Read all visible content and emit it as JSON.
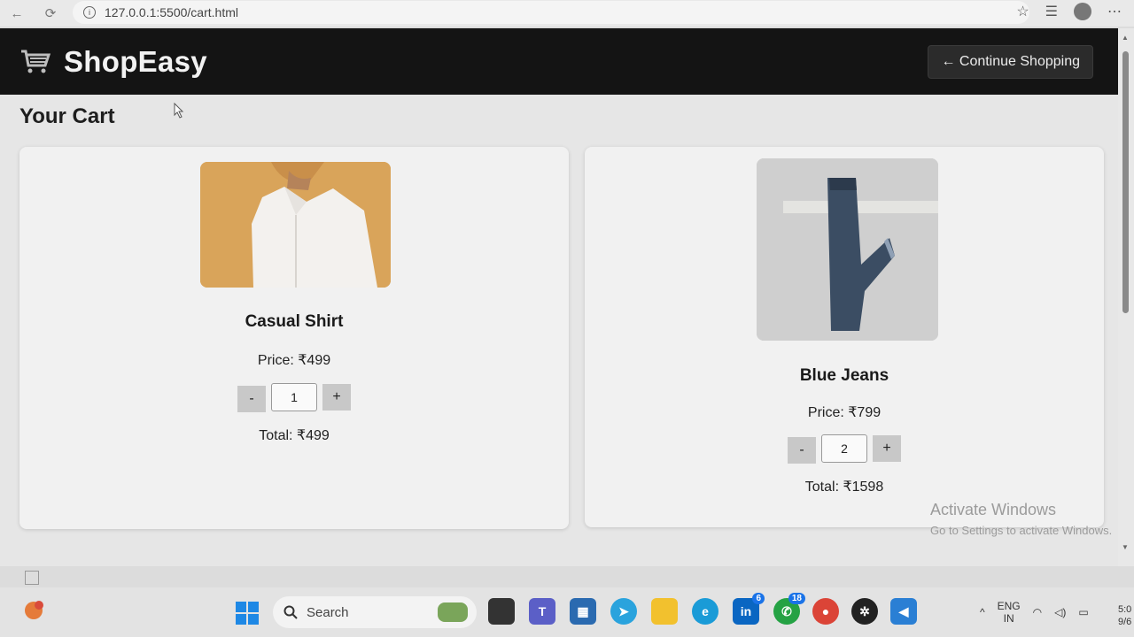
{
  "browser": {
    "url": "127.0.0.1:5500/cart.html"
  },
  "header": {
    "brand_name": "ShopEasy",
    "continue_label": "← Continue Shopping"
  },
  "cart": {
    "title": "Your Cart",
    "items": [
      {
        "name": "Casual Shirt",
        "price_text": "Price: ₹499",
        "minus": "-",
        "plus": "+",
        "quantity": "1",
        "total_text": "Total: ₹499"
      },
      {
        "name": "Blue Jeans",
        "price_text": "Price: ₹799",
        "minus": "-",
        "plus": "+",
        "quantity": "2",
        "total_text": "Total: ₹1598"
      }
    ]
  },
  "watermark": {
    "line1": "Activate Windows",
    "line2": "Go to Settings to activate Windows."
  },
  "taskbar": {
    "search_label": "Search",
    "linkedin_badge": "6",
    "whatsapp_badge": "18",
    "lang_line1": "ENG",
    "lang_line2": "IN",
    "clock_line1": "5:0",
    "clock_line2": "9/6"
  },
  "colors": {
    "header_bg": "#141414",
    "card_bg": "#f1f1f1",
    "shirt_backdrop": "#d9a45a"
  }
}
